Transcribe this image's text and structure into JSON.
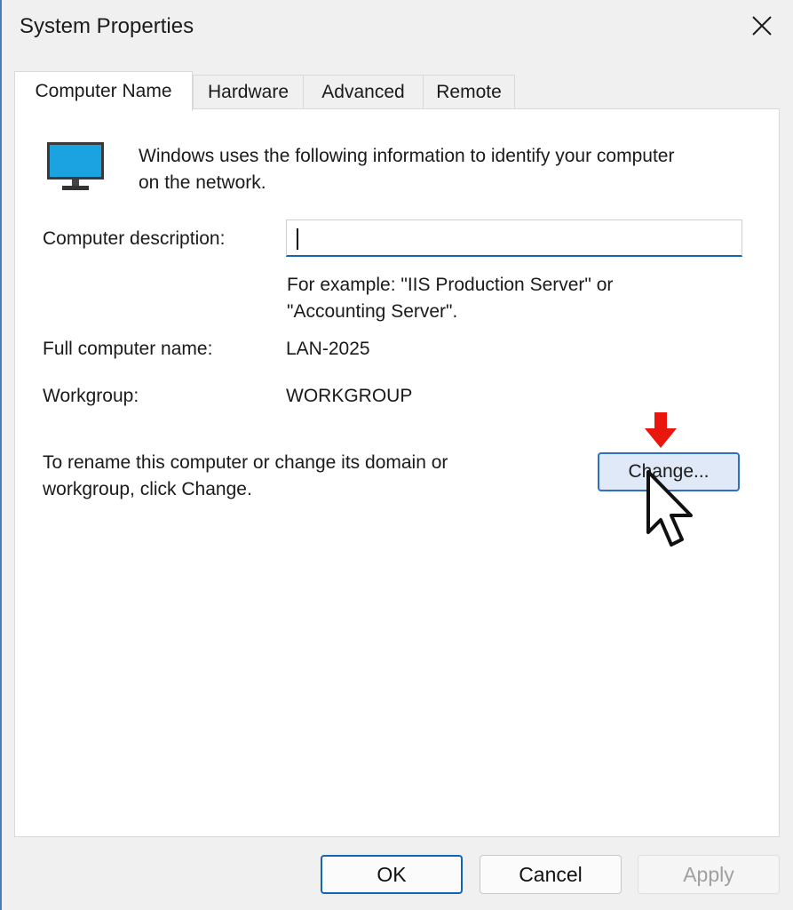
{
  "window": {
    "title": "System Properties"
  },
  "tabs": [
    {
      "label": "Computer Name",
      "active": true
    },
    {
      "label": "Hardware",
      "active": false
    },
    {
      "label": "Advanced",
      "active": false
    },
    {
      "label": "Remote",
      "active": false
    }
  ],
  "panel": {
    "intro_line1": "Windows uses the following information to identify your computer",
    "intro_line2": "on the network.",
    "description_label": "Computer description:",
    "description_value": "",
    "hint_line1": "For example: \"IIS Production Server\" or",
    "hint_line2": "\"Accounting Server\".",
    "full_name_label": "Full computer name:",
    "full_name_value": "LAN-2025",
    "workgroup_label": "Workgroup:",
    "workgroup_value": "WORKGROUP",
    "rename_line1": "To rename this computer or change its domain or",
    "rename_line2": "workgroup, click Change.",
    "change_label": "Change..."
  },
  "footer": {
    "ok_label": "OK",
    "cancel_label": "Cancel",
    "apply_label": "Apply"
  },
  "icons": {
    "monitor": "monitor-icon",
    "close": "close-icon",
    "annotation_arrow": "red-arrow-down-icon",
    "pointer": "mouse-pointer-icon"
  },
  "colors": {
    "accent": "#1466b5",
    "annotation": "#e8160c",
    "monitor_screen": "#1aa3e0"
  }
}
